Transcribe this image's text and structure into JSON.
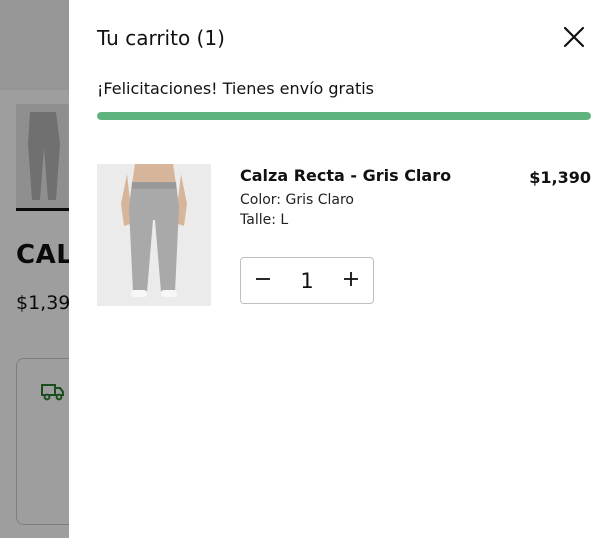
{
  "background_page": {
    "product_title": "CAL",
    "product_price": "$1,39"
  },
  "cart": {
    "title": "Tu carrito (1)",
    "free_shipping_message": "¡Felicitaciones! Tienes envío gratis",
    "free_shipping_progress": 1.0,
    "progress_color": "#5fb37d",
    "items": [
      {
        "name": "Calza Recta - Gris Claro",
        "price": "$1,390",
        "color": "Color: Gris Claro",
        "size": "Talle: L",
        "quantity": "1"
      }
    ]
  },
  "icons": {
    "close": "close-icon",
    "minus": "minus-icon",
    "plus": "plus-icon",
    "truck": "truck-icon"
  }
}
